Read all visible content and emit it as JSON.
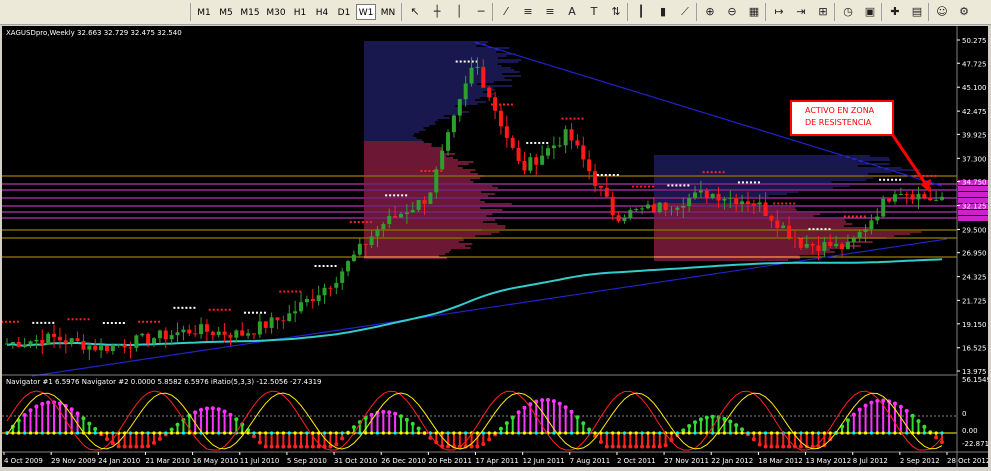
{
  "toolbar": {
    "timeframes": [
      "M1",
      "M5",
      "M15",
      "M30",
      "H1",
      "H4",
      "D1",
      "W1",
      "MN"
    ],
    "active_timeframe": "W1",
    "icons": [
      "cursor-icon",
      "crosshair-icon",
      "vertical-line-icon",
      "horizontal-line-icon",
      "trendline-icon",
      "channel-icon",
      "fibonacci-icon",
      "text-icon",
      "label-icon",
      "arrows-icon",
      "bar-chart-icon",
      "candle-chart-icon",
      "line-chart-icon",
      "zoom-in-icon",
      "zoom-out-icon",
      "tile-icon",
      "autoscroll-icon",
      "chart-shift-icon",
      "indicators-icon",
      "period-icon",
      "templates-icon",
      "new-order-icon",
      "history-icon",
      "expert-icon",
      "options-icon"
    ]
  },
  "colors": {
    "background": "#000000",
    "bull_candle": "#2e9e2e",
    "bear_candle": "#ff1a1a",
    "ma_line": "#33cccc",
    "trendline": "#2222cc",
    "annotation": "#ff0000",
    "volume_profile_blue": "#3a3ab8",
    "volume_profile_pink": "#ff3a7a",
    "resistance_magenta": "#e040e0"
  },
  "main_chart": {
    "header": "XAGUSDpro,Weekly  32.663 32.729 32.475 32.540",
    "annotation": "ACTIVO EN ZONA DE RESISTENCIA",
    "price_labels": [
      "50.275",
      "47.725",
      "45.100",
      "42.475",
      "39.925",
      "37.300",
      "34.750",
      "32.125",
      "29.500",
      "26.950",
      "24.325",
      "21.725",
      "19.150",
      "16.525",
      "13.975"
    ],
    "ylim": [
      13.975,
      50.275
    ]
  },
  "indicator": {
    "header": "Navigator #1 6.5976  Navigator #2 0.0000 5.8582 6.5976  iRatio(5,3,3) -12.5056 -27.4319",
    "scale_labels": [
      "56.1549",
      "0",
      "0.00",
      "-22.8716"
    ]
  },
  "x_axis": {
    "labels": [
      "4 Oct 2009",
      "29 Nov 2009",
      "24 Jan 2010",
      "21 Mar 2010",
      "16 May 2010",
      "11 Jul 2010",
      "5 Sep 2010",
      "31 Oct 2010",
      "26 Dec 2010",
      "20 Feb 2011",
      "17 Apr 2011",
      "12 Jun 2011",
      "7 Aug 2011",
      "2 Oct 2011",
      "27 Nov 2011",
      "22 Jan 2012",
      "18 Mar 2012",
      "13 May 2012",
      "8 Jul 2012",
      "2 Sep 2012",
      "28 Oct 2012"
    ]
  },
  "chart_data": {
    "type": "line",
    "title": "XAGUSDpro,Weekly",
    "x": [
      "4 Oct 2009",
      "29 Nov 2009",
      "24 Jan 2010",
      "21 Mar 2010",
      "16 May 2010",
      "11 Jul 2010",
      "5 Sep 2010",
      "31 Oct 2010",
      "26 Dec 2010",
      "20 Feb 2011",
      "17 Apr 2011",
      "12 Jun 2011",
      "7 Aug 2011",
      "2 Oct 2011",
      "27 Nov 2011",
      "22 Jan 2012",
      "18 Mar 2012",
      "13 May 2012",
      "8 Jul 2012",
      "2 Sep 2012",
      "28 Oct 2012"
    ],
    "series": [
      {
        "values": [
          17.0,
          17.6,
          16.5,
          17.5,
          18.5,
          18.0,
          20.0,
          24.0,
          30.0,
          33.0,
          48.0,
          36.0,
          40.0,
          31.0,
          32.0,
          33.5,
          32.5,
          28.0,
          27.5,
          34.0,
          32.5
        ]
      }
    ],
    "ohlc_last": {
      "open": 32.663,
      "high": 32.729,
      "low": 32.475,
      "close": 32.54
    },
    "ylim": [
      13.975,
      50.275
    ]
  }
}
